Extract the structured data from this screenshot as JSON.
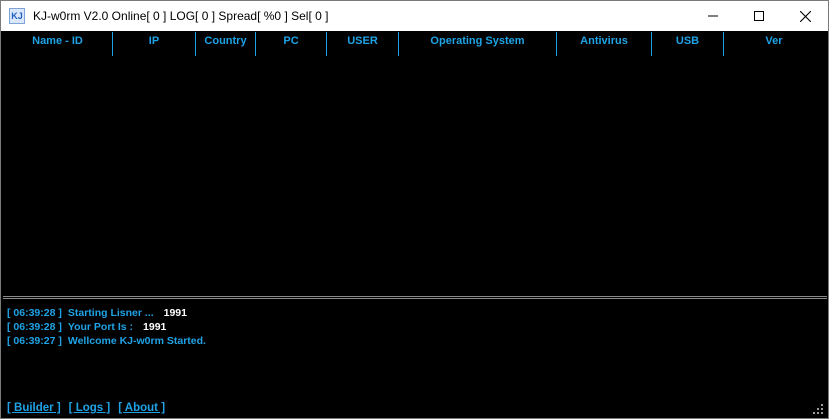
{
  "window": {
    "title": "KJ-w0rm V2.0 Online[ 0 ] LOG[ 0 ] Spread[ %0 ] Sel[ 0 ]",
    "icon_text": "KJ",
    "controls": [
      "minimize-icon",
      "maximize-icon",
      "close-icon"
    ]
  },
  "grid": {
    "columns": [
      "Name - ID",
      "IP",
      "Country",
      "PC",
      "USER",
      "Operating System",
      "Antivirus",
      "USB",
      "Ver"
    ],
    "rows": []
  },
  "log": [
    {
      "time": "[ 06:39:28 ]",
      "message": "Starting Lisner ...",
      "value": "1991"
    },
    {
      "time": "[ 06:39:28 ]",
      "message": "Your Port Is :",
      "value": "1991"
    },
    {
      "time": "[ 06:39:27 ]",
      "message": "Wellcome KJ-w0rm Started.",
      "value": ""
    }
  ],
  "links": {
    "builder": "[ Builder ]",
    "logs": "[ Logs ]",
    "about": "[ About ]"
  },
  "colors": {
    "accent": "#1fa3e6",
    "background": "#000000",
    "value_text": "#ffffff"
  }
}
